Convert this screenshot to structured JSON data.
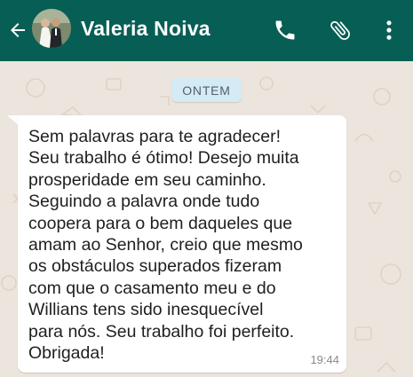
{
  "header": {
    "contact_name": "Valeria Noiva",
    "back_icon": "arrow-left-icon",
    "avatar": "contact-avatar",
    "actions": [
      "phone-icon",
      "paperclip-icon",
      "more-vert-icon"
    ],
    "background_color": "#075e54"
  },
  "chat": {
    "date_divider": "ONTEM",
    "messages": [
      {
        "direction": "incoming",
        "text": "Sem palavras para te agradecer!\nSeu trabalho é ótimo! Desejo muita\nprosperidade em seu caminho.\nSeguindo a palavra onde tudo\ncoopera para o bem daqueles que\namam ao Senhor, creio que mesmo\nos obstáculos superados fizeram\ncom que o casamento meu e do\nWillians tens sido inesquecível\npara nós. Seu trabalho foi perfeito.\nObrigada!",
        "time": "19:44"
      }
    ]
  }
}
